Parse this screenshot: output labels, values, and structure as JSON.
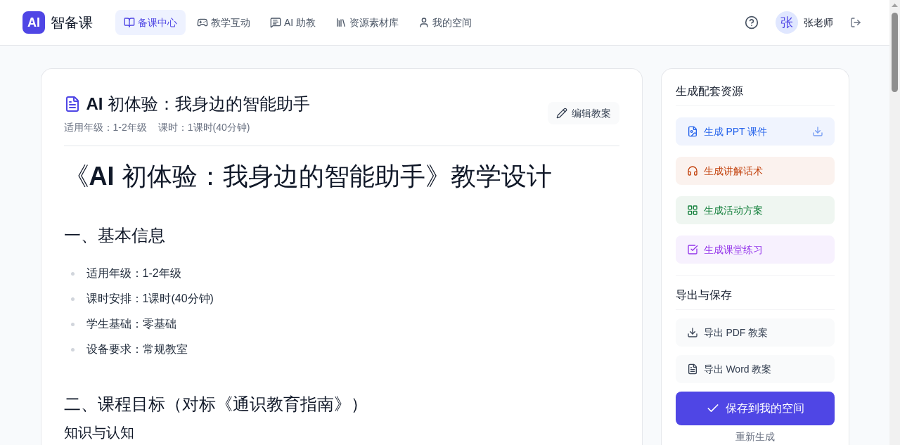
{
  "app": {
    "logo_mark": "AI",
    "name": "智备课"
  },
  "nav": [
    {
      "label": "备课中心",
      "selected": true
    },
    {
      "label": "教学互动",
      "selected": false
    },
    {
      "label": "AI 助教",
      "selected": false
    },
    {
      "label": "资源素材库",
      "selected": false
    },
    {
      "label": "我的空间",
      "selected": false
    }
  ],
  "user": {
    "avatar_initial": "张",
    "name": "张老师"
  },
  "lesson": {
    "title": "**AI** 初体验：我身边的智能助手",
    "meta": [
      "适用年级：1-2年级",
      "课时：1课时(40分钟)"
    ],
    "edit_button": "编辑教案"
  },
  "document": {
    "title": "《**AI** 初体验：我身边的智能助手》教学设计",
    "sections": [
      {
        "heading": "一、基本信息",
        "items": [
          "适用年级：1-2年级",
          "课时安排：1课时(40分钟)",
          "学生基础：零基础",
          "设备要求：常规教室"
        ]
      },
      {
        "heading": "二、课程目标（对标《通识教育指南》）",
        "subheading": "知识与认知"
      }
    ]
  },
  "sidebar": {
    "generate": {
      "title": "生成配套资源",
      "actions": [
        {
          "label": "生成 PPT 课件",
          "color": "#2563eb",
          "download_icon": true
        },
        {
          "label": "生成讲解话术",
          "color": "#c2410c",
          "download_icon": false
        },
        {
          "label": "生成活动方案",
          "color": "#15803d",
          "download_icon": false
        },
        {
          "label": "生成课堂练习",
          "color": "#9333ea",
          "download_icon": false
        }
      ]
    },
    "export": {
      "title": "导出与保存",
      "actions": [
        "导出 PDF 教案",
        "导出 Word 教案"
      ],
      "save_button": "保存到我的空间",
      "regenerate_link": "重新生成"
    }
  }
}
